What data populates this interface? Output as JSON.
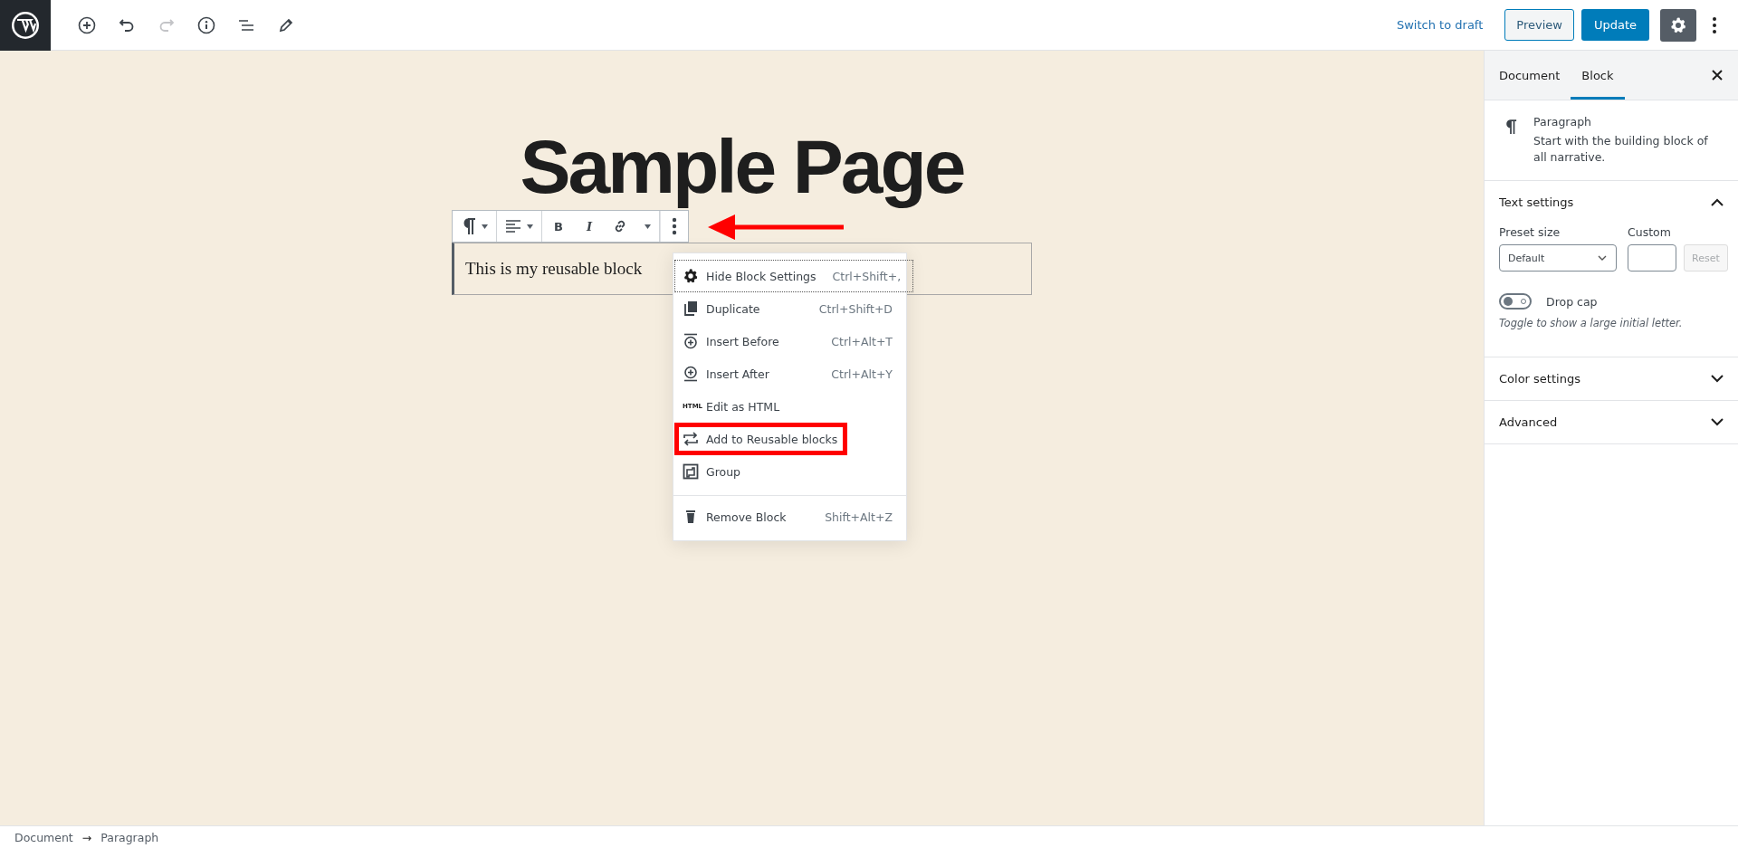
{
  "topbar": {
    "tools": [
      {
        "kind": "add",
        "disabled": false
      },
      {
        "kind": "undo",
        "disabled": false
      },
      {
        "kind": "redo",
        "disabled": true
      },
      {
        "kind": "info",
        "disabled": false
      },
      {
        "kind": "outline",
        "disabled": false
      },
      {
        "kind": "edit",
        "disabled": false
      }
    ],
    "switch_link": "Switch to draft",
    "preview": "Preview",
    "update": "Update",
    "settings_pressed": true
  },
  "editor": {
    "title": "Sample Page",
    "toolbar": [
      {
        "kind": "paragraph",
        "caret": true
      },
      {
        "kind": "align",
        "caret": true
      },
      {
        "kind": "bold",
        "label": "B"
      },
      {
        "kind": "italic",
        "label": "I"
      },
      {
        "kind": "link"
      },
      {
        "kind": "more-format",
        "caret": true
      },
      {
        "kind": "more"
      }
    ],
    "paragraph": "This is my reusable block",
    "arrow_to_more": true
  },
  "menu": {
    "items": [
      {
        "kind": "gear",
        "label": "Hide Block Settings",
        "shortcut": "Ctrl+Shift+,",
        "focused": true,
        "highlighted": false,
        "separated": false
      },
      {
        "kind": "duplicate",
        "label": "Duplicate",
        "shortcut": "Ctrl+Shift+D",
        "focused": false,
        "highlighted": false,
        "separated": false
      },
      {
        "kind": "insert-before",
        "label": "Insert Before",
        "shortcut": "Ctrl+Alt+T",
        "focused": false,
        "highlighted": false,
        "separated": false
      },
      {
        "kind": "insert-after",
        "label": "Insert After",
        "shortcut": "Ctrl+Alt+Y",
        "focused": false,
        "highlighted": false,
        "separated": false
      },
      {
        "kind": "html",
        "icon_text": "HTML",
        "label": "Edit as HTML",
        "focused": false,
        "highlighted": false,
        "separated": false
      },
      {
        "kind": "reusable",
        "label": "Add to Reusable blocks",
        "focused": false,
        "highlighted": true,
        "separated": false
      },
      {
        "kind": "group",
        "label": "Group",
        "focused": false,
        "highlighted": false,
        "separated": false
      },
      {
        "kind": "trash",
        "label": "Remove Block",
        "shortcut": "Shift+Alt+Z",
        "focused": false,
        "highlighted": false,
        "separated": true
      }
    ]
  },
  "sidebar": {
    "tabs": [
      {
        "label": "Document",
        "selected": false
      },
      {
        "label": "Block",
        "selected": true
      }
    ],
    "block": {
      "title": "Paragraph",
      "description": "Start with the building block of all narrative."
    },
    "panels": [
      {
        "kind": "text",
        "title": "Text settings",
        "expanded": true
      },
      {
        "kind": "color",
        "title": "Color settings",
        "expanded": false
      },
      {
        "kind": "advanced",
        "title": "Advanced",
        "expanded": false
      }
    ],
    "text_settings": {
      "preset_label": "Preset size",
      "preset_value": "Default",
      "custom_label": "Custom",
      "reset": "Reset",
      "dropcap_label": "Drop cap",
      "dropcap_checked": false,
      "dropcap_help": "Toggle to show a large initial letter."
    }
  },
  "footer": {
    "crumbs": [
      "Document",
      "Paragraph"
    ],
    "separator": "→"
  }
}
